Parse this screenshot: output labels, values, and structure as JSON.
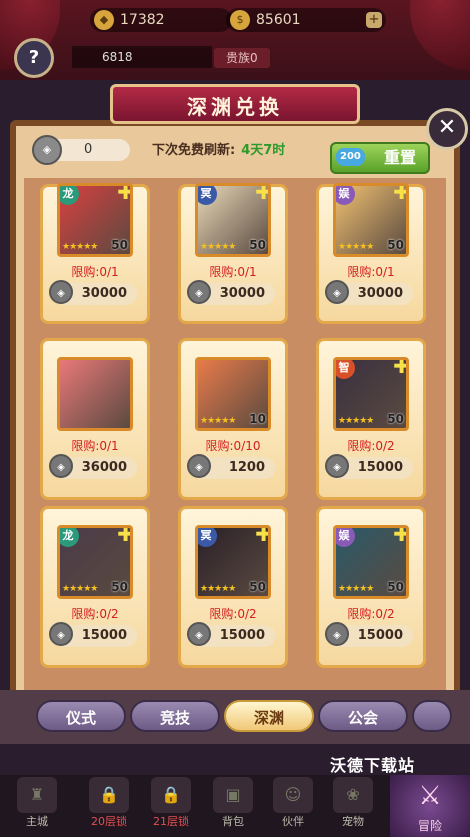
{
  "top": {
    "resource1_value": "17382",
    "gold_value": "85601",
    "power_value": "6818",
    "noble_label": "贵族0"
  },
  "panel": {
    "title": "深渊兑换",
    "token_count": "0",
    "refresh_label": "下次免费刷新:",
    "refresh_time": "4天7时",
    "reset_cost": "200",
    "reset_label": "重置"
  },
  "cards": [
    {
      "element": "龙",
      "element_color": "#2a9a7a",
      "level": "50",
      "limit": "限购:0/1",
      "price": "30000",
      "type": "hero",
      "portrait_color": "#d84040"
    },
    {
      "element": "冥",
      "element_color": "#3a5aa8",
      "level": "50",
      "limit": "限购:0/1",
      "price": "30000",
      "type": "hero",
      "portrait_color": "#e8d8b8"
    },
    {
      "element": "娱",
      "element_color": "#8a5ab8",
      "level": "50",
      "limit": "限购:0/1",
      "price": "30000",
      "type": "hero",
      "portrait_color": "#f0c070"
    },
    {
      "element": "",
      "element_color": "",
      "level": "",
      "limit": "限购:0/1",
      "price": "36000",
      "type": "chest",
      "portrait_color": "#e87878"
    },
    {
      "element": "",
      "element_color": "",
      "level": "10",
      "limit": "限购:0/10",
      "price": "1200",
      "type": "puzzle",
      "portrait_color": "#e87b4a"
    },
    {
      "element": "智",
      "element_color": "#d8502a",
      "level": "50",
      "limit": "限购:0/2",
      "price": "15000",
      "type": "hero",
      "portrait_color": "#3a3040"
    },
    {
      "element": "龙",
      "element_color": "#2a9a7a",
      "level": "50",
      "limit": "限购:0/2",
      "price": "15000",
      "type": "hero",
      "portrait_color": "#4a3a48"
    },
    {
      "element": "冥",
      "element_color": "#3a5aa8",
      "level": "50",
      "limit": "限购:0/2",
      "price": "15000",
      "type": "hero",
      "portrait_color": "#2a2028"
    },
    {
      "element": "娱",
      "element_color": "#8a5ab8",
      "level": "50",
      "limit": "限购:0/2",
      "price": "15000",
      "type": "hero",
      "portrait_color": "#2a5a6a"
    }
  ],
  "tabs": [
    "仪式",
    "竞技",
    "深渊",
    "公会"
  ],
  "active_tab": "深渊",
  "watermark": "沃德下载站",
  "bottom_nav": {
    "items": [
      "主城",
      "20层锁",
      "21层锁",
      "背包",
      "伙伴",
      "宠物"
    ],
    "adventure": "冒险"
  }
}
